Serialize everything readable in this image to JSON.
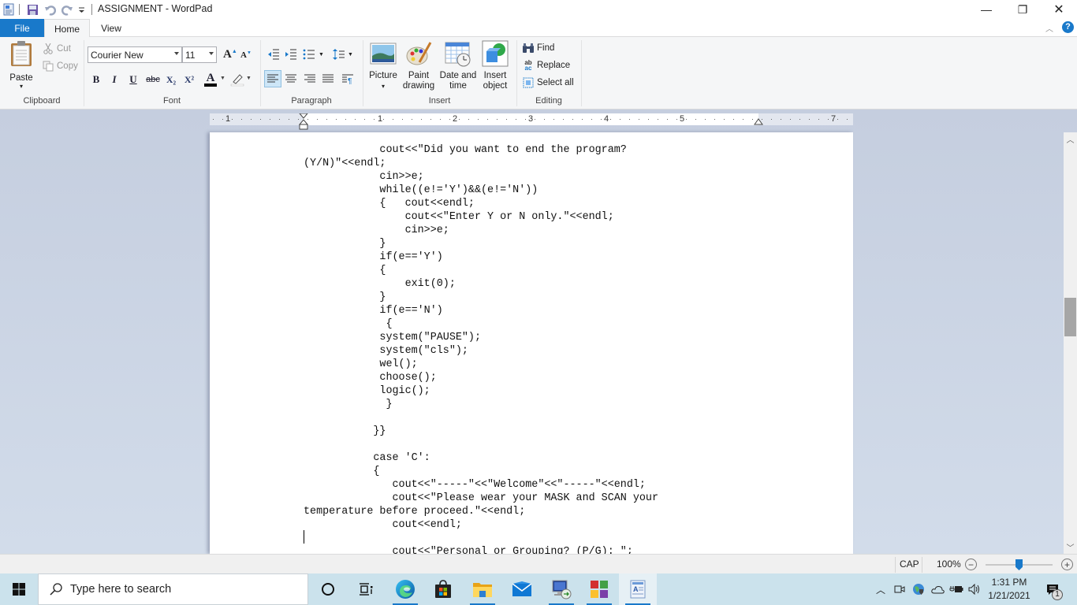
{
  "titlebar": {
    "title": "ASSIGNMENT - WordPad",
    "quick_access": [
      "save-icon",
      "undo-icon",
      "redo-icon",
      "customize-quick-access-icon"
    ],
    "window_controls": {
      "minimize": "—",
      "restore": "❐",
      "close": "✕"
    }
  },
  "tabs": [
    {
      "label": "File",
      "active": false
    },
    {
      "label": "Home",
      "active": true
    },
    {
      "label": "View",
      "active": false
    }
  ],
  "ribbon": {
    "clipboard": {
      "label": "Clipboard",
      "paste": "Paste",
      "cut": "Cut",
      "copy": "Copy"
    },
    "font": {
      "label": "Font",
      "family": "Courier New",
      "size": "11",
      "grow": "A",
      "shrink": "A",
      "bold": "B",
      "italic": "I",
      "underline": "U",
      "strikethrough": "abc",
      "subscript": "X₂",
      "superscript": "X²",
      "text_color": "A",
      "text_color_hex": "#000000"
    },
    "paragraph": {
      "label": "Paragraph",
      "alignment_active": "left"
    },
    "insert": {
      "label": "Insert",
      "picture": "Picture",
      "paint_drawing_1": "Paint",
      "paint_drawing_2": "drawing",
      "date_time_1": "Date and",
      "date_time_2": "time",
      "insert_object_1": "Insert",
      "insert_object_2": "object"
    },
    "editing": {
      "label": "Editing",
      "find": "Find",
      "replace": "Replace",
      "select_all": "Select all"
    }
  },
  "ruler": {
    "numbers": [
      "1",
      "1",
      "2",
      "3",
      "4",
      "5",
      "7"
    ]
  },
  "document": {
    "lines": [
      "            cout<<\"Did you want to end the program?",
      "(Y/N)\"<<endl;",
      "            cin>>e;",
      "            while((e!='Y')&&(e!='N'))",
      "            {   cout<<endl;",
      "                cout<<\"Enter Y or N only.\"<<endl;",
      "                cin>>e;",
      "            }",
      "            if(e=='Y')",
      "            {",
      "                exit(0);",
      "            }",
      "            if(e=='N')",
      "             {",
      "            system(\"PAUSE\");",
      "            system(\"cls\");",
      "            wel();",
      "            choose();",
      "            logic();",
      "             }",
      "",
      "           }}",
      "",
      "           case 'C':",
      "           {",
      "              cout<<\"-----\"<<\"Welcome\"<<\"-----\"<<endl;",
      "              cout<<\"Please wear your MASK and SCAN your",
      "temperature before proceed.\"<<endl;",
      "              cout<<endl;",
      "",
      "              cout<<\"Personal or Grouping? (P/G): \";"
    ]
  },
  "statusbar": {
    "caps": "CAP",
    "zoom_level": "100%",
    "zoom_percent": 100,
    "zoom_out": "−",
    "zoom_in": "+"
  },
  "taskbar": {
    "search_placeholder": "Type here to search",
    "apps": [
      {
        "name": "cortana",
        "running": false
      },
      {
        "name": "task-view",
        "running": false
      },
      {
        "name": "edge",
        "running": true
      },
      {
        "name": "microsoft-store",
        "running": false
      },
      {
        "name": "file-explorer",
        "running": true
      },
      {
        "name": "mail",
        "running": false
      },
      {
        "name": "remote-desktop",
        "running": true
      },
      {
        "name": "colorful-app",
        "running": true
      },
      {
        "name": "wordpad",
        "running": true,
        "active": true
      }
    ],
    "clock_time": "1:31 PM",
    "clock_date": "1/21/2021",
    "notification_count": "1"
  }
}
